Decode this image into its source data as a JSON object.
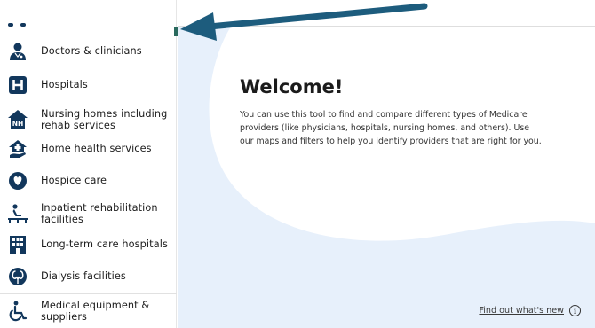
{
  "sidebar": {
    "items": [
      {
        "label": "Doctors & clinicians",
        "icon": "doctor-icon"
      },
      {
        "label": "Hospitals",
        "icon": "hospital-icon"
      },
      {
        "label": "Nursing homes including rehab services",
        "icon": "nursing-home-icon"
      },
      {
        "label": "Home health services",
        "icon": "home-health-icon"
      },
      {
        "label": "Hospice care",
        "icon": "hospice-icon"
      },
      {
        "label": "Inpatient rehabilitation facilities",
        "icon": "rehab-icon"
      },
      {
        "label": "Long-term care hospitals",
        "icon": "ltc-hospital-icon"
      },
      {
        "label": "Dialysis facilities",
        "icon": "dialysis-icon"
      },
      {
        "label": "Medical equipment & suppliers",
        "icon": "wheelchair-icon"
      }
    ]
  },
  "main": {
    "title": "Welcome!",
    "body": "You can use this tool to find and compare different types of Medicare providers (like physicians, hospitals, nursing homes, and others). Use our maps and filters to help you identify providers that are right for you.",
    "whats_new_link": "Find out what's new",
    "info_glyph": "i"
  },
  "colors": {
    "icon_navy": "#12375c",
    "accent_green": "#2a6a5e",
    "arrow_teal": "#1d5c7d",
    "blob_blue": "#e7f0fb"
  }
}
